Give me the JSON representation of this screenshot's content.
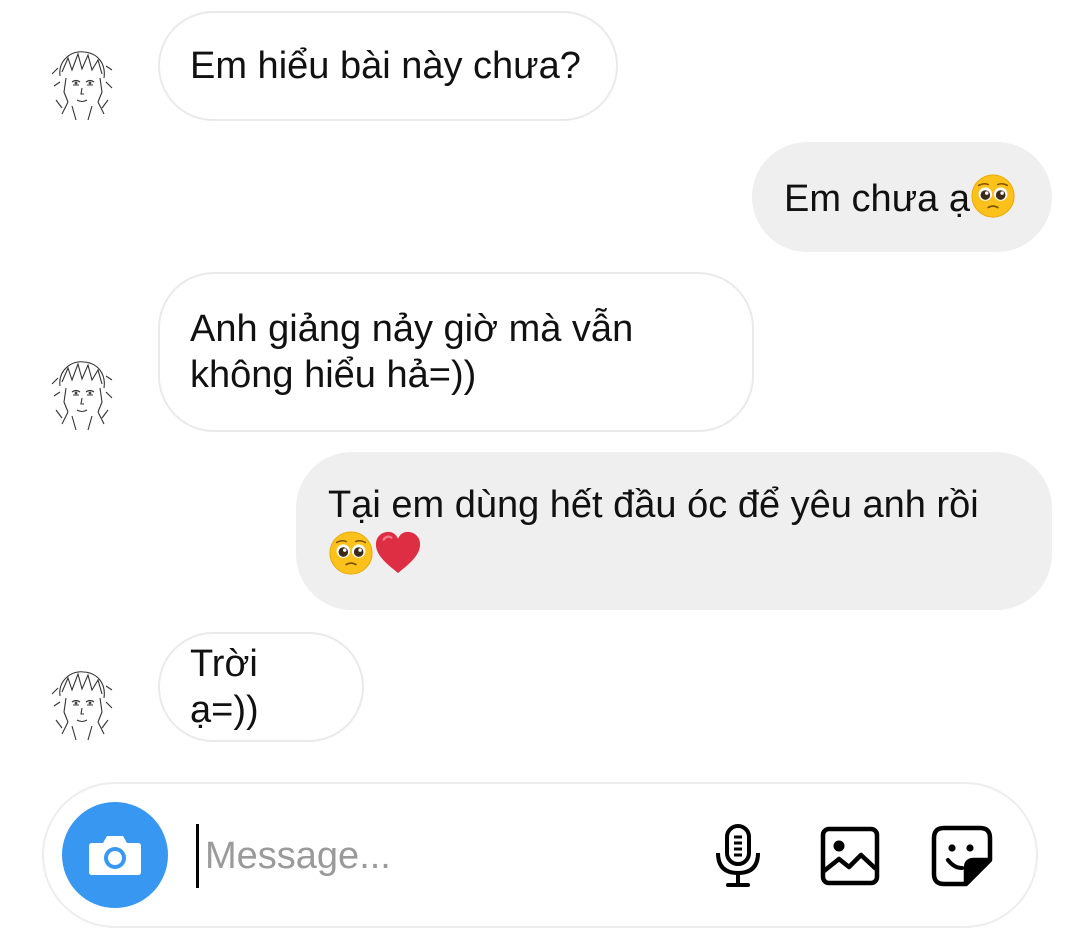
{
  "messages": [
    {
      "direction": "incoming",
      "text": "Em hiểu bài này chưa?"
    },
    {
      "direction": "outgoing",
      "text": "Em chưa ạ",
      "emoji": [
        "pleading-face"
      ]
    },
    {
      "direction": "incoming",
      "lines": [
        "Anh giảng nảy giờ mà vẫn",
        "không hiểu hả=))"
      ]
    },
    {
      "direction": "outgoing",
      "lines": [
        "Tại em dùng hết đầu óc để yêu anh rồi"
      ],
      "emoji": [
        "pleading-face",
        "red-heart"
      ]
    },
    {
      "direction": "incoming",
      "text": "Trời ạ=))"
    }
  ],
  "composer": {
    "placeholder": "Message...",
    "value": "",
    "icons": [
      "camera-icon",
      "microphone-icon",
      "gallery-icon",
      "sticker-icon"
    ]
  },
  "colors": {
    "camera_button": "#3897f0",
    "outgoing_bubble": "#efefef",
    "incoming_border": "#eaeaea",
    "heart": "#e0245e"
  }
}
